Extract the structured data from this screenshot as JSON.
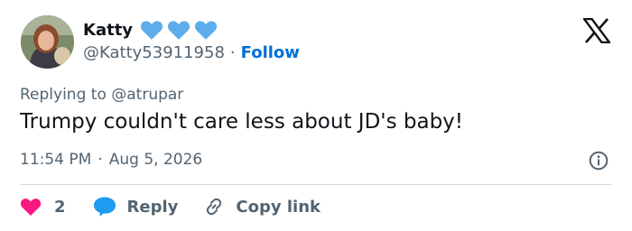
{
  "author": {
    "display_name": "Katty",
    "emoji": [
      "blue-heart",
      "blue-heart",
      "blue-heart"
    ],
    "handle": "@Katty53911958",
    "separator": "·",
    "follow_label": "Follow"
  },
  "tweet": {
    "replying_prefix": "Replying to",
    "replying_to": "@atrupar",
    "text": "Trumpy couldn't care less about JD's baby!",
    "time": "11:54 PM",
    "separator": "·",
    "date": "Aug 5, 2026"
  },
  "actions": {
    "like_count": "2",
    "reply_label": "Reply",
    "copy_link_label": "Copy link"
  },
  "colors": {
    "heart_pink": "#f91880",
    "reply_blue": "#1d9bf0",
    "follow_blue": "#006fd6",
    "emoji_blue": "#5dadec"
  }
}
